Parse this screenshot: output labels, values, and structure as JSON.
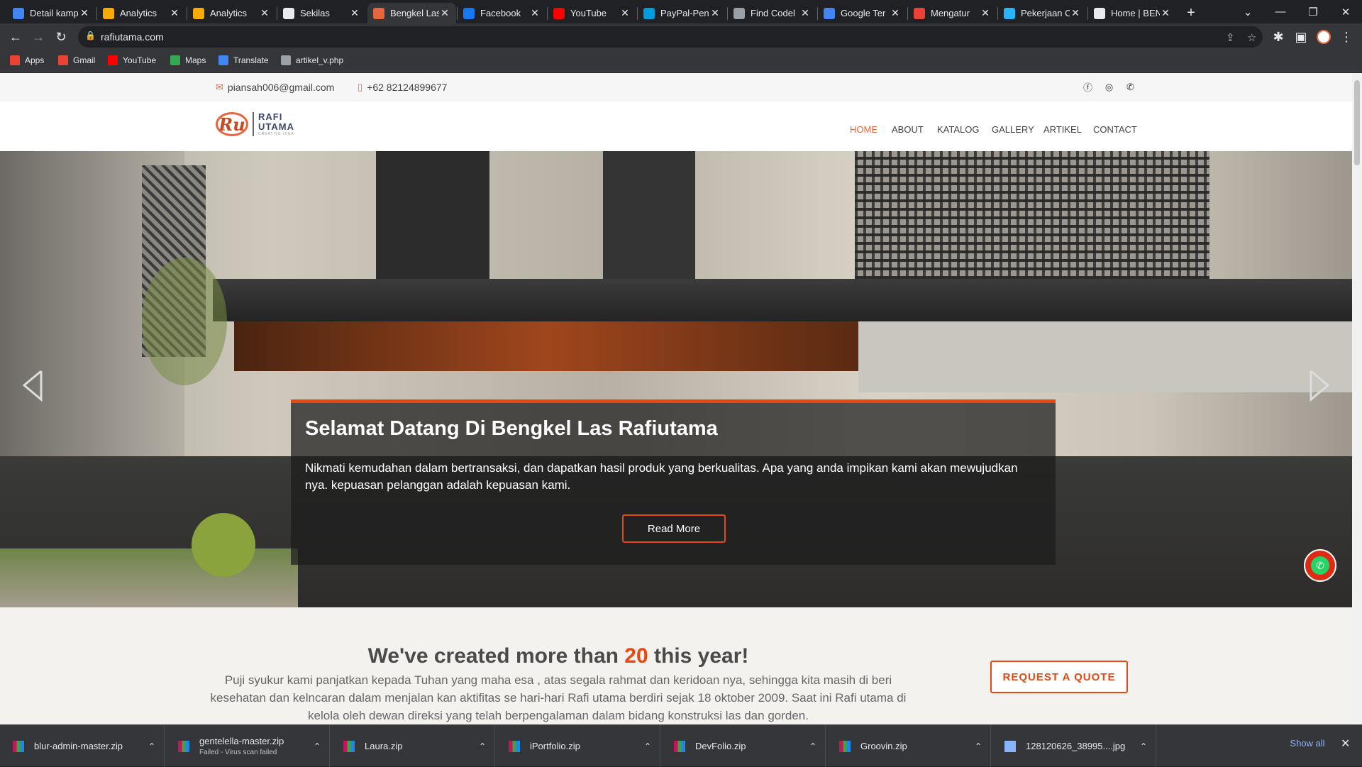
{
  "browser": {
    "tabs": [
      {
        "title": "Detail kamp",
        "icon": "google-ads-icon",
        "color": "#4285f4"
      },
      {
        "title": "Analytics",
        "icon": "analytics-icon",
        "color": "#f9ab00"
      },
      {
        "title": "Analytics",
        "icon": "analytics-icon",
        "color": "#f9ab00"
      },
      {
        "title": "Sekilas",
        "icon": "car-icon",
        "color": "#e8eaed"
      },
      {
        "title": "Bengkel Las",
        "icon": "site-icon",
        "color": "#e8663d",
        "active": true
      },
      {
        "title": "Facebook",
        "icon": "facebook-icon",
        "color": "#1877f2"
      },
      {
        "title": "YouTube",
        "icon": "youtube-icon",
        "color": "#ff0000"
      },
      {
        "title": "PayPal-Pen",
        "icon": "paypal-icon",
        "color": "#009cde"
      },
      {
        "title": "Find Codel",
        "icon": "codelab-icon",
        "color": "#9aa0a6"
      },
      {
        "title": "Google Ter",
        "icon": "translate-icon",
        "color": "#4285f4"
      },
      {
        "title": "Mengatur",
        "icon": "gmail-icon",
        "color": "#ea4335"
      },
      {
        "title": "Pekerjaan C",
        "icon": "freelancer-icon",
        "color": "#29b2fe"
      },
      {
        "title": "Home | BEN",
        "icon": "doc-icon",
        "color": "#e8eaed"
      }
    ],
    "new_tab": "+",
    "url": "rafiutama.com",
    "bookmarks": [
      {
        "label": "Apps",
        "icon": "apps-grid-icon",
        "color": "#ea4335"
      },
      {
        "label": "Gmail",
        "icon": "gmail-icon",
        "color": "#ea4335"
      },
      {
        "label": "YouTube",
        "icon": "youtube-icon",
        "color": "#ff0000"
      },
      {
        "label": "Maps",
        "icon": "maps-icon",
        "color": "#34a853"
      },
      {
        "label": "Translate",
        "icon": "translate-icon",
        "color": "#4285f4"
      },
      {
        "label": "artikel_v.php",
        "icon": "globe-icon",
        "color": "#9aa0a6"
      }
    ]
  },
  "site": {
    "email": "piansah006@gmail.com",
    "phone": "+62 82124899677",
    "logo": {
      "line1": "RAFI",
      "line2": "UTAMA",
      "mark": "Ru",
      "tagline": "CREATIVE IDEA"
    },
    "nav": [
      "HOME",
      "ABOUT",
      "KATALOG",
      "GALLERY",
      "ARTIKEL",
      "CONTACT"
    ],
    "active_nav": "HOME",
    "hero": {
      "title": "Selamat Datang Di Bengkel Las Rafiutama",
      "text": "Nikmati kemudahan dalam bertransaksi, dan dapatkan hasil produk yang berkualitas. Apa yang anda impikan kami akan mewujudkan nya. kepuasan pelanggan adalah kepuasan kami.",
      "button": "Read More"
    },
    "about": {
      "heading_pre": "We've created more than ",
      "heading_num": "20",
      "heading_post": " this year!",
      "text": "Puji syukur kami panjatkan kepada Tuhan yang maha esa , atas segala rahmat dan keridoan nya, sehingga kita masih di beri kesehatan dan kelncaran dalam menjalan kan aktifitas se hari-hari Rafi utama berdiri sejak 18 oktober 2009. Saat ini Rafi utama di kelola oleh dewan direksi yang telah berpengalaman dalam bidang konstruksi las dan gorden.",
      "quote_button": "REQUEST A QUOTE"
    },
    "accent": "#e8470f"
  },
  "downloads": {
    "items": [
      {
        "name": "blur-admin-master.zip",
        "status": ""
      },
      {
        "name": "gentelella-master.zip",
        "status": "Failed - Virus scan failed"
      },
      {
        "name": "Laura.zip",
        "status": ""
      },
      {
        "name": "iPortfolio.zip",
        "status": ""
      },
      {
        "name": "DevFolio.zip",
        "status": ""
      },
      {
        "name": "Groovin.zip",
        "status": ""
      },
      {
        "name": "128120626_38995....jpg",
        "status": ""
      }
    ],
    "show_all": "Show all"
  }
}
